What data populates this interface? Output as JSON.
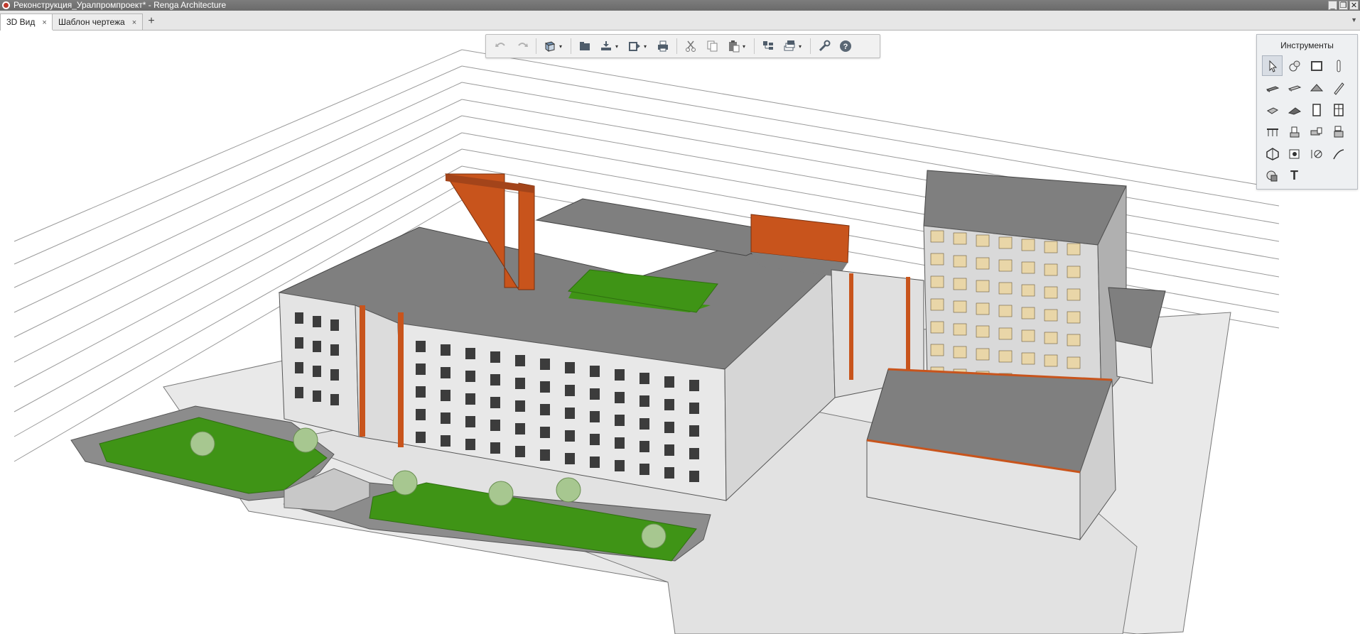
{
  "window": {
    "title": "Реконструкция_Уралпромпроект* - Renga Architecture",
    "controls": [
      "minimize-icon",
      "restore-icon",
      "close-icon"
    ]
  },
  "tabs": [
    {
      "label": "3D Вид",
      "active": true,
      "close": "×"
    },
    {
      "label": "Шаблон чертежа",
      "active": false,
      "close": "×"
    }
  ],
  "tab_add": "+",
  "tab_menu": "▼",
  "toolbar": {
    "buttons": [
      "undo-icon",
      "redo-icon",
      "view-cube-icon",
      "open-folder-icon",
      "import-icon",
      "export-icon",
      "print-icon",
      "cut-icon",
      "copy-icon",
      "paste-icon",
      "object-structure-icon",
      "levels-icon",
      "settings-wrench-icon",
      "help-icon"
    ],
    "dropdown_marker": "▾"
  },
  "tools_panel": {
    "title": "Инструменты",
    "text_tool_label": "T",
    "selected_tool": "select-tool"
  },
  "colors": {
    "roof": "#7f7f7f",
    "accent_orange": "#c8541c",
    "wall": "#e7e7e7",
    "lawn": "#3c8f14",
    "window_fill": "#e9d6a8"
  }
}
